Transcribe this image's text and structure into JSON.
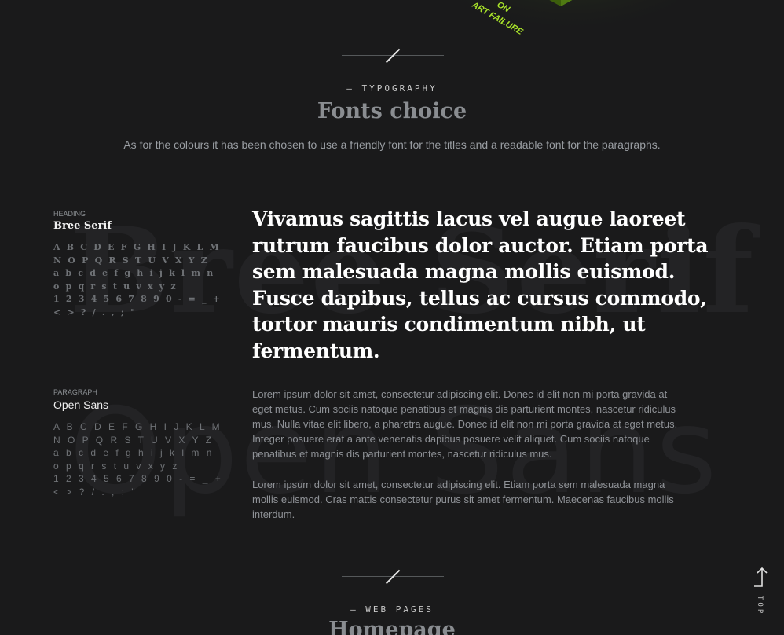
{
  "top_art": {
    "text_1": "ON",
    "text_2": "ART FAILURE",
    "accent": "#a8e22a"
  },
  "typography": {
    "eyebrow": "— TYPOGRAPHY",
    "title": "Fonts choice",
    "description": "As for the colours it has been chosen to use a friendly font for the titles and a readable font for the paragraphs."
  },
  "heading_font": {
    "label": "HEADING",
    "name": "Bree Serif",
    "background_word": "Bree Serif",
    "glyph_lines": [
      "A B C D E F G H I J K L M",
      "N O P Q R S T U V X Y Z",
      "a b c d e f g h i j k l m n",
      "o p q r s t u v x y z",
      "1 2 3 4 5 6 7 8 9 0 - = _ +",
      "< > ? / . , ; \""
    ],
    "sample": "Vivamus sagittis lacus vel augue laoreet rutrum faucibus dolor auctor. Etiam porta sem malesuada magna mollis euismod. Fusce dapibus, tellus ac cursus commodo, tortor mauris condimentum nibh, ut fermentum."
  },
  "paragraph_font": {
    "label": "PARAGRAPH",
    "name": "Open Sans",
    "background_word": "Open Sans",
    "glyph_lines": [
      "A B C D E F G H I J K L M",
      "N O P Q R S T U V X Y Z",
      "a b c d e f g h i j k l m n",
      "o p q r s t u v x y z",
      "1 2 3 4 5 6 7 8 9 0 - = _ +",
      "< > ? / . , ; \""
    ],
    "sample_1": "Lorem ipsum dolor sit amet, consectetur adipiscing elit. Donec id elit non mi porta gravida at eget metus. Cum sociis natoque penatibus et magnis dis parturient montes, nascetur ridiculus mus. Nulla vitae elit libero, a pharetra augue. Donec id elit non mi porta gravida at eget metus. Integer posuere erat a ante venenatis dapibus posuere velit aliquet. Cum sociis natoque penatibus et magnis dis parturient montes, nascetur ridiculus mus.",
    "sample_2": "Lorem ipsum dolor sit amet, consectetur adipiscing elit. Etiam porta sem malesuada magna mollis euismod. Cras mattis consectetur purus sit amet fermentum. Maecenas faucibus mollis interdum."
  },
  "web_pages": {
    "eyebrow": "— WEB PAGES",
    "title": "Homepage"
  },
  "top_button": {
    "label": "TOP",
    "icon": "arrow-up-icon"
  }
}
